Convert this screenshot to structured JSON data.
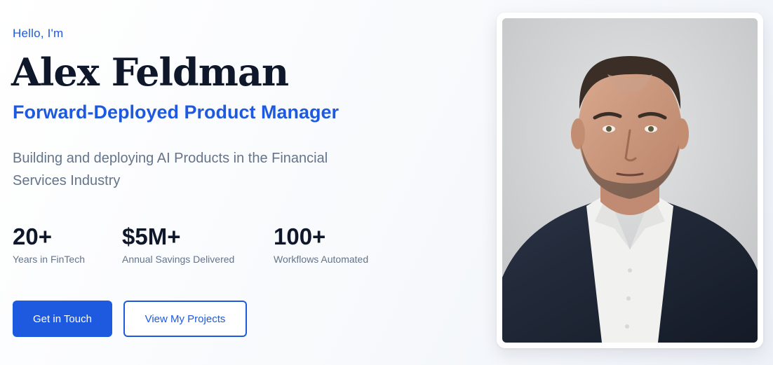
{
  "hero": {
    "greeting": "Hello, I'm",
    "name": "Alex Feldman",
    "role": "Forward-Deployed Product Manager",
    "tagline": "Building and deploying AI Products in the Financial Services Industry"
  },
  "stats": [
    {
      "value": "20+",
      "label": "Years in FinTech"
    },
    {
      "value": "$5M+",
      "label": "Annual Savings Delivered"
    },
    {
      "value": "100+",
      "label": "Workflows Automated"
    }
  ],
  "actions": {
    "primary_label": "Get in Touch",
    "secondary_label": "View My Projects"
  },
  "colors": {
    "accent": "#1d5ae0",
    "heading": "#0f172a",
    "muted": "#64748b"
  },
  "photo": {
    "icon": "portrait-photo"
  }
}
